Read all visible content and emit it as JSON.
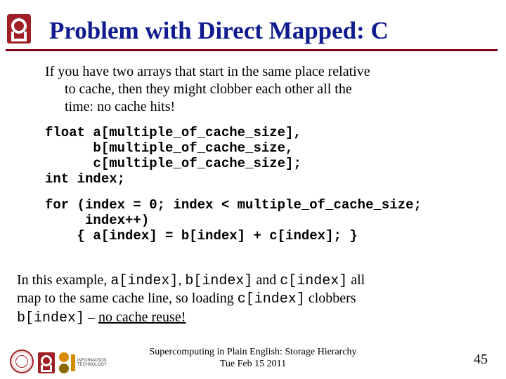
{
  "title": "Problem with Direct Mapped: C",
  "intro": {
    "l1": "If you have two arrays that start in the same place relative",
    "l2": "to cache, then they might clobber each other all the",
    "l3": "time: no cache hits!"
  },
  "code1": "float a[multiple_of_cache_size],\n      b[multiple_of_cache_size,\n      c[multiple_of_cache_size];\nint index;",
  "code2": "for (index = 0; index < multiple_of_cache_size;\n     index++)\n    { a[index] = b[index] + c[index]; }",
  "explain": {
    "pre1": "In this example, ",
    "a": "a[index]",
    "sep1": ", ",
    "b": "b[index]",
    "mid1": " and ",
    "c": "c[index]",
    "post1": " all",
    "line2a": "map to the same cache line, so loading ",
    "c2": "c[index]",
    "line2b": " clobbers",
    "b2": "b[index]",
    "dash": " – ",
    "nocache": "no cache reuse!"
  },
  "footer": {
    "l1": "Supercomputing in Plain English: Storage Hierarchy",
    "l2": "Tue Feb 15 2011"
  },
  "it_label": "INFORMATION\nTECHNOLOGY",
  "page": "45"
}
